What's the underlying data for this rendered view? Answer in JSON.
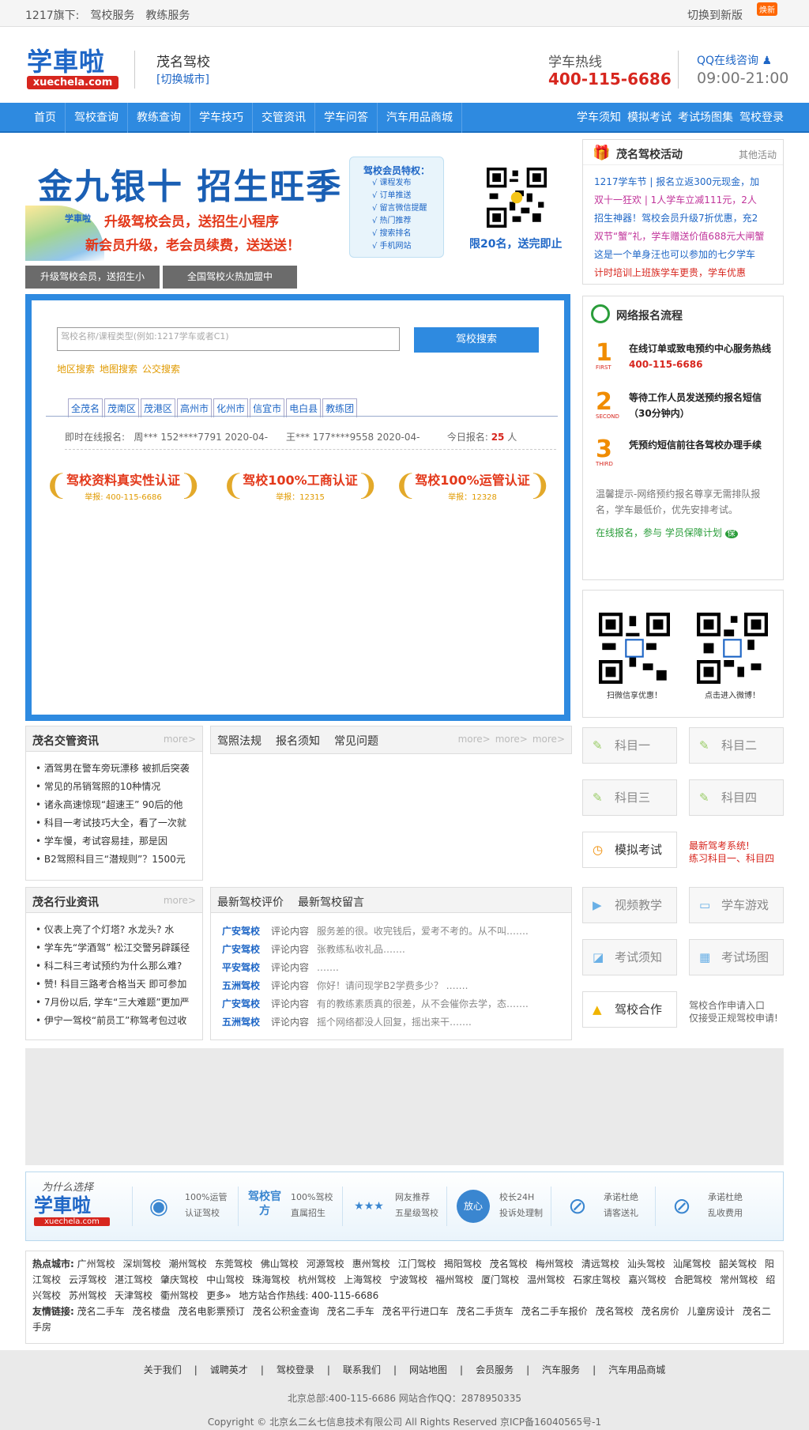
{
  "topbar": {
    "label": "1217旗下:",
    "links": [
      "驾校服务",
      "教练服务"
    ],
    "switch": "切换到新版",
    "new_badge": "焕新"
  },
  "header": {
    "logo_text": "学車啦",
    "logo_url": "xuechela.com",
    "school": "茂名驾校",
    "switch_city": "[切换城市]",
    "hotline_label": "学车热线",
    "hotline": "400-115-6686",
    "qq": "QQ在线咨询",
    "hours": "09:00-21:00"
  },
  "nav": {
    "items": [
      "首页",
      "驾校查询",
      "教练查询",
      "学车技巧",
      "交管资讯",
      "学车问答",
      "汽车用品商城"
    ],
    "right": [
      "学车须知",
      "模拟考试",
      "考试场图集",
      "驾校登录"
    ]
  },
  "banner": {
    "title": "金九银十 招生旺季",
    "line1": "升级驾校会员，送招生小程序",
    "line2": "新会员升级，老会员续费，送送送！",
    "mini_logo": "学車啦",
    "member_title": "驾校会员特权：",
    "member_items": [
      "√ 课程发布",
      "√ 订单推送",
      "√ 留言微信提醒",
      "√ 热门推荐",
      "√ 搜索排名",
      "√ 手机网站"
    ],
    "limit": "限20名，送完即止",
    "tabs": [
      "升级驾校会员，送招生小",
      "全国驾校火热加盟中"
    ]
  },
  "search": {
    "placeholder": "驾校名称/课程类型(例如:1217学车或者C1)",
    "button": "驾校搜索",
    "links": [
      "地区搜索",
      "地图搜索",
      "公交搜索"
    ],
    "areas": [
      "全茂名",
      "茂南区",
      "茂港区",
      "高州市",
      "化州市",
      "信宜市",
      "电白县",
      "教练团"
    ],
    "online_label": "即时在线报名:",
    "online1": "周*** 152****7791 2020-04-",
    "online2": "王*** 177****9558 2020-04-",
    "today_label": "今日报名:",
    "today_count": "25",
    "today_unit": "人"
  },
  "certs": [
    {
      "title": "驾校资料真实性认证",
      "sub": "举报: 400-115-6686"
    },
    {
      "title": "驾校100%工商认证",
      "sub": "举报：12315"
    },
    {
      "title": "驾校100%运管认证",
      "sub": "举报：12328"
    }
  ],
  "activity": {
    "title": "茂名驾校活动",
    "more": "其他活动",
    "items": [
      {
        "text": "1217学车节 | 报名立返300元现金，加",
        "color": "#1e66c6"
      },
      {
        "text": "双十一狂欢 | 1人学车立减111元，2人",
        "color": "#c0339a"
      },
      {
        "text": "招生神器！驾校会员升级7折优惠，充2",
        "color": "#1e66c6"
      },
      {
        "text": "双节“蟹”礼，学车赠送价值688元大闸蟹",
        "color": "#c0339a"
      },
      {
        "text": "这是一个单身汪也可以参加的七夕学车",
        "color": "#1e66c6"
      },
      {
        "text": "计时培训上班族学车更贵，学车优惠",
        "color": "#d7261e"
      }
    ]
  },
  "flow": {
    "title": "网络报名流程",
    "steps": [
      {
        "n": "1",
        "s": "FIRST",
        "d": "在线订单或致电预约中心服务热线",
        "phone": "400-115-6686"
      },
      {
        "n": "2",
        "s": "SECOND",
        "d": "等待工作人员发送预约报名短信（30分钟内）",
        "phone": ""
      },
      {
        "n": "3",
        "s": "THIRD",
        "d": "凭预约短信前往各驾校办理手续",
        "phone": ""
      }
    ],
    "tip": "温馨提示-网络预约报名尊享无需排队报名，学车最低价，优先安排考试。",
    "guarantee": "在线报名，参与  学员保障计划",
    "guarantee_badge": "保"
  },
  "qrs": {
    "captions": [
      "扫微信享优惠！",
      "点击进入微博！"
    ]
  },
  "news_traffic": {
    "title": "茂名交管资讯",
    "more": "more>",
    "items": [
      "酒驾男在警车旁玩漂移 被抓后突袭",
      "常见的吊销驾照的10种情况",
      "诸永高速惊现“超速王” 90后的他",
      "科目一考试技巧大全，看了一次就",
      "学车慢，考试容易挂，那是因",
      "B2驾照科目三“潜规则”？1500元"
    ]
  },
  "news_tabs": {
    "tabs": [
      "驾照法规",
      "报名须知",
      "常见问题"
    ],
    "mores": [
      "more>",
      "more>",
      "more>"
    ]
  },
  "news_industry": {
    "title": "茂名行业资讯",
    "more": "more>",
    "items": [
      "仪表上亮了个灯塔? 水龙头? 水",
      "学车先“学酒驾” 松江交警另辟蹊径",
      "科二科三考试预约为什么那么难?",
      "赞! 科目三路考合格当天 即可参加",
      "7月份以后, 学车“三大难题”更加严",
      "伊宁一驾校“前员工”称驾考包过收"
    ]
  },
  "evals": {
    "tabs": [
      "最新驾校评价",
      "最新驾校留言"
    ],
    "items": [
      {
        "s": "广安驾校",
        "c": "评论内容",
        "x": "服务差的很。收完钱后，爱考不考的。从不叫……."
      },
      {
        "s": "广安驾校",
        "c": "评论内容",
        "x": "张教练私收礼品……."
      },
      {
        "s": "平安驾校",
        "c": "评论内容",
        "x": "……."
      },
      {
        "s": "五洲驾校",
        "c": "评论内容",
        "x": "你好！请问现学B2学费多少？ ……."
      },
      {
        "s": "广安驾校",
        "c": "评论内容",
        "x": "有的教练素质真的很差，从不会催你去学，态……."
      },
      {
        "s": "五洲驾校",
        "c": "评论内容",
        "x": "摇个网络都没人回复，摇出来干……."
      }
    ]
  },
  "tiles": {
    "items": [
      "科目一",
      "科目二",
      "科目三",
      "科目四",
      "模拟考试",
      "视频教学",
      "学车游戏",
      "考试须知",
      "考试场图",
      "驾校合作"
    ],
    "exam_note1": "最新驾考系统!",
    "exam_note2": "练习科目一、科目四",
    "coop_note1": "驾校合作申请入口",
    "coop_note2": "仅接受正规驾校申请!"
  },
  "why": {
    "q": "为什么选择",
    "logo": "学車啦",
    "logo_url": "xuechela.com",
    "items": [
      {
        "icon": "◉",
        "a": "100%运管",
        "b": "认证驾校"
      },
      {
        "icon": "驾校官方",
        "a": "100%驾校",
        "b": "直属招生"
      },
      {
        "icon": "★★★",
        "a": "网友推荐",
        "b": "五星级驾校"
      },
      {
        "icon": "放心",
        "a": "校长24H",
        "b": "投诉处理制"
      },
      {
        "icon": "⊘",
        "a": "承诺杜绝",
        "b": "请客送礼"
      },
      {
        "icon": "⊘",
        "a": "承诺杜绝",
        "b": "乱收费用"
      }
    ]
  },
  "links": {
    "hot_label": "热点城市:",
    "hot": [
      "广州驾校",
      "深圳驾校",
      "潮州驾校",
      "东莞驾校",
      "佛山驾校",
      "河源驾校",
      "惠州驾校",
      "江门驾校",
      "揭阳驾校",
      "茂名驾校",
      "梅州驾校",
      "清远驾校",
      "汕头驾校",
      "汕尾驾校",
      "韶关驾校",
      "阳江驾校",
      "云浮驾校",
      "湛江驾校",
      "肇庆驾校",
      "中山驾校",
      "珠海驾校",
      "杭州驾校",
      "上海驾校",
      "宁波驾校",
      "福州驾校",
      "厦门驾校",
      "温州驾校",
      "石家庄驾校",
      "嘉兴驾校",
      "合肥驾校",
      "常州驾校",
      "绍兴驾校",
      "苏州驾校",
      "天津驾校",
      "衢州驾校",
      "更多»"
    ],
    "hotline": "地方站合作热线: 400-115-6686",
    "friend_label": "友情链接:",
    "friends": [
      "茂名二手车",
      "茂名楼盘",
      "茂名电影票预订",
      "茂名公积金查询",
      "茂名二手车",
      "茂名平行进口车",
      "茂名二手货车",
      "茂名二手车报价",
      "茂名驾校",
      "茂名房价",
      "儿童房设计",
      "茂名二手房"
    ]
  },
  "footer": {
    "nav": [
      "关于我们",
      "诚聘英才",
      "驾校登录",
      "联系我们",
      "网站地图",
      "会员服务",
      "汽车服务",
      "汽车用品商城"
    ],
    "contact": "北京总部:400-115-6686 网站合作QQ：2878950335",
    "copy": "Copyright © 北京幺二幺七信息技术有限公司 All Rights Reserved 京ICP备16040565号-1"
  }
}
